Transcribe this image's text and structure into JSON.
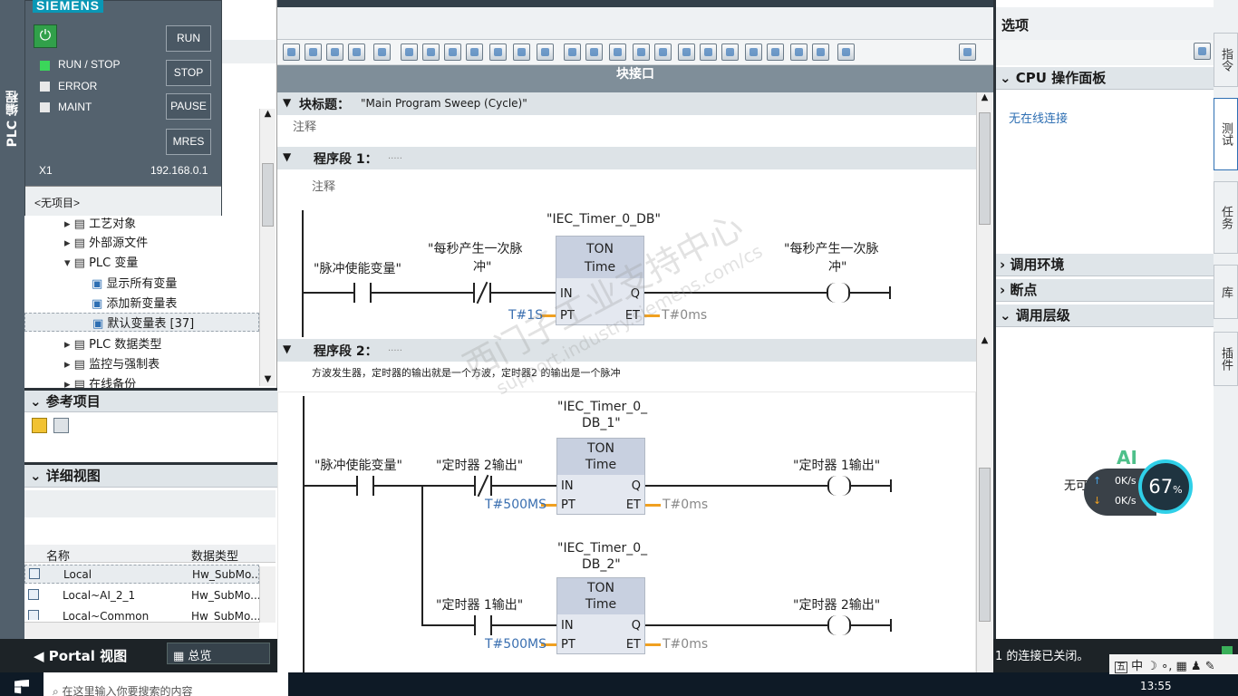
{
  "plc_panel": {
    "brand": "SIEMENS",
    "run_stop": "RUN / STOP",
    "error": "ERROR",
    "maint": "MAINT",
    "btn_run": "RUN",
    "btn_stop": "STOP",
    "btn_pause": "PAUSE",
    "btn_mres": "MRES",
    "x1": "X1",
    "ip": "192.168.0.1",
    "no_project": "<无项目>"
  },
  "left_vert_tab": "PLC 编程",
  "tree": {
    "items": [
      {
        "label": "工艺对象"
      },
      {
        "label": "外部源文件"
      },
      {
        "label": "PLC 变量"
      },
      {
        "label": "显示所有变量"
      },
      {
        "label": "添加新变量表"
      },
      {
        "label": "默认变量表 [37]"
      },
      {
        "label": "PLC 数据类型"
      },
      {
        "label": "监控与强制表"
      },
      {
        "label": "在线备份"
      }
    ]
  },
  "ref_projects": {
    "title": "参考项目"
  },
  "detail_view": {
    "title": "详细视图",
    "col_name": "名称",
    "col_type": "数据类型",
    "rows": [
      {
        "name": "Local",
        "type": "Hw_SubMo..."
      },
      {
        "name": "Local~AI_2_1",
        "type": "Hw_SubMo..."
      },
      {
        "name": "Local~Common",
        "type": "Hw_SubMo..."
      }
    ]
  },
  "bottom_bar": {
    "portal": "Portal 视图",
    "overview": "总览",
    "status": "1 的连接已关闭。"
  },
  "editor": {
    "block_interface": "块接口",
    "block_title_label": "块标题：",
    "block_title_value": "\"Main Program Sweep (Cycle)\"",
    "comment": "注释",
    "network1": {
      "label": "程序段 1：",
      "dots": ".....",
      "comment": "注释",
      "db": "\"IEC_Timer_0_DB\"",
      "contact1": "\"脉冲使能变量\"",
      "contact2_l1": "\"每秒产生一次脉",
      "contact2_l2": "冲\"",
      "coil_l1": "\"每秒产生一次脉",
      "coil_l2": "冲\"",
      "ton": "TON",
      "time": "Time",
      "pin_in": "IN",
      "pin_pt": "PT",
      "pin_q": "Q",
      "pin_et": "ET",
      "pt_val": "T#1S",
      "et_val": "T#0ms"
    },
    "network2": {
      "label": "程序段 2：",
      "dots": ".....",
      "comment": "方波发生器，定时器的输出就是一个方波，定时器2 的输出是一个脉冲",
      "db1_l1": "\"IEC_Timer_0_",
      "db1_l2": "DB_1\"",
      "db2_l1": "\"IEC_Timer_0_",
      "db2_l2": "DB_2\"",
      "contact1": "\"脉冲使能变量\"",
      "contact2": "\"定时器 2输出\"",
      "contact3": "\"定时器 1输出\"",
      "coil1": "\"定时器 1输出\"",
      "coil2": "\"定时器 2输出\"",
      "pt1": "T#500MS",
      "pt2": "T#500MS",
      "et1": "T#0ms",
      "et2": "T#0ms",
      "ton": "TON",
      "time": "Time",
      "pin_in": "IN",
      "pin_pt": "PT",
      "pin_q": "Q",
      "pin_et": "ET"
    },
    "watermark1": "西门子工业支持中心",
    "watermark2": "support.industry.siemens.com/cs"
  },
  "right_panel": {
    "title": "选项",
    "cpu_panel": "CPU 操作面板",
    "no_online": "无在线连接",
    "call_env": "调用环境",
    "breakpoint": "断点",
    "call_level": "调用层级",
    "vtab1": "指令",
    "vtab2": "测试",
    "vtab3": "任务",
    "vtab4": "库",
    "vtab5": "插件"
  },
  "net_widget": {
    "ai": "AI",
    "no_label": "无可",
    "up": "0K/s",
    "down": "0K/s",
    "percent": "67",
    "unit": "%"
  },
  "taskbar": {
    "search": "在这里输入你要搜索的内容",
    "ime": "中",
    "time": "13:55"
  }
}
